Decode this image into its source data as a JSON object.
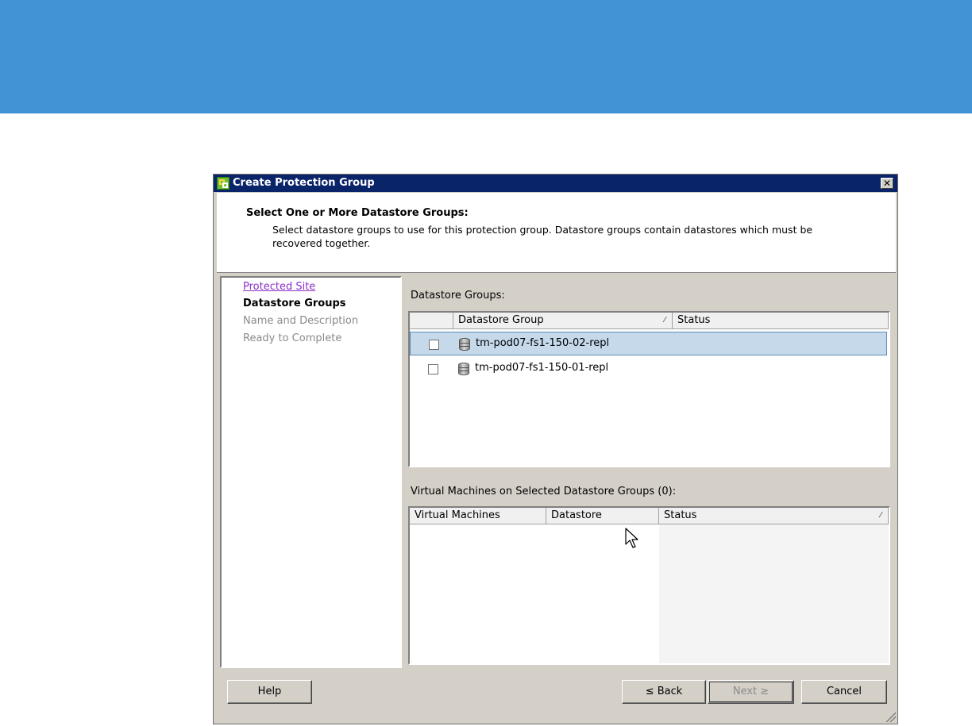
{
  "window": {
    "title": "Create Protection Group",
    "close_symbol": "✕"
  },
  "header": {
    "title": "Select One or More Datastore Groups:",
    "description": "Select datastore groups to use for this protection group. Datastore groups contain datastores which must be recovered together."
  },
  "steps": [
    {
      "label": "Protected Site",
      "state": "completed"
    },
    {
      "label": "Datastore Groups",
      "state": "current"
    },
    {
      "label": "Name and Description",
      "state": "future"
    },
    {
      "label": "Ready to Complete",
      "state": "future"
    }
  ],
  "datastore_groups": {
    "label": "Datastore Groups:",
    "columns": [
      "Datastore Group",
      "Status"
    ],
    "sort_indicator": "⁄",
    "rows": [
      {
        "name": "tm-pod07-fs1-150-02-repl",
        "checked": false,
        "selected": true
      },
      {
        "name": "tm-pod07-fs1-150-01-repl",
        "checked": false,
        "selected": false
      }
    ]
  },
  "virtual_machines": {
    "label": "Virtual Machines on Selected Datastore Groups (0):",
    "columns": [
      "Virtual Machines",
      "Datastore",
      "Status"
    ],
    "sort_indicator": "⁄",
    "rows": []
  },
  "buttons": {
    "help": "Help",
    "back": "≤ Back",
    "next": "Next ≥",
    "cancel": "Cancel"
  },
  "colors": {
    "banner": "#4193d6",
    "titlebar": "#0a246a",
    "selected_row": "#c5d9eb",
    "link_visited": "#8b2fc9"
  },
  "icons": [
    "app-icon",
    "close-icon",
    "datastore-icon",
    "sort-icon",
    "resize-grip-icon",
    "cursor-icon"
  ]
}
